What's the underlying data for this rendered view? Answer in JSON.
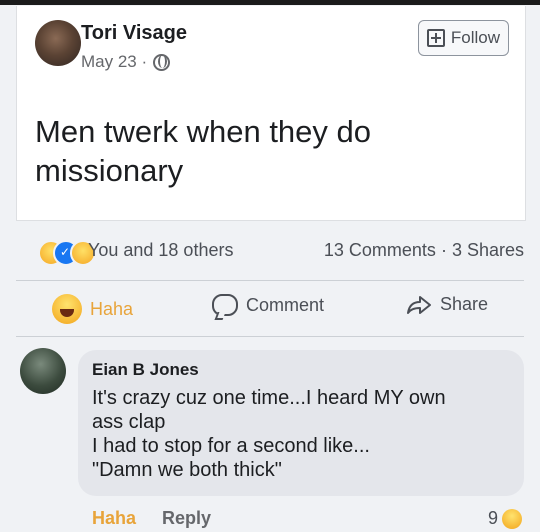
{
  "post": {
    "author": "Tori Visage",
    "date": "May 23 ·",
    "follow_label": "Follow",
    "text": "Men twerk when they do missionary"
  },
  "reactions": {
    "summary": "You and 18 others",
    "comments_count": "13 Comments",
    "shares_count": "3 Shares",
    "separator": "·"
  },
  "actions": {
    "haha_label": "Haha",
    "comment_label": "Comment",
    "share_label": "Share"
  },
  "comment": {
    "author": "Eian B Jones",
    "lines": [
      "It's crazy cuz one time...I heard MY own",
      "ass clap",
      "I had to stop for a second like...",
      "\"Damn we both thick\""
    ],
    "haha_label": "Haha",
    "reply_label": "Reply",
    "reaction_count": "9"
  },
  "colors": {
    "background": "#f0f2f5",
    "haha_accent": "#e8a43a",
    "like_blue": "#1877f2"
  }
}
